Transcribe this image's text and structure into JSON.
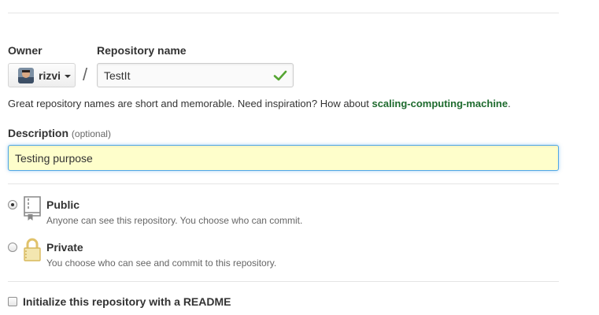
{
  "owner": {
    "label": "Owner",
    "selected": "rizvi"
  },
  "separator": "/",
  "repository": {
    "label": "Repository name",
    "value": "TestIt",
    "valid_color": "#55a532"
  },
  "hint": {
    "text": "Great repository names are short and memorable. Need inspiration? How about ",
    "suggestion": "scaling-computing-machine",
    "suffix": "."
  },
  "description": {
    "label": "Description",
    "optional": "(optional)",
    "value": "Testing purpose"
  },
  "visibility": {
    "public": {
      "title": "Public",
      "description": "Anyone can see this repository. You choose who can commit.",
      "checked": true,
      "icon": "repo-book-icon"
    },
    "private": {
      "title": "Private",
      "description": "You choose who can see and commit to this repository.",
      "checked": false,
      "icon": "lock-icon"
    }
  },
  "readme": {
    "label": "Initialize this repository with a README",
    "checked": false
  }
}
